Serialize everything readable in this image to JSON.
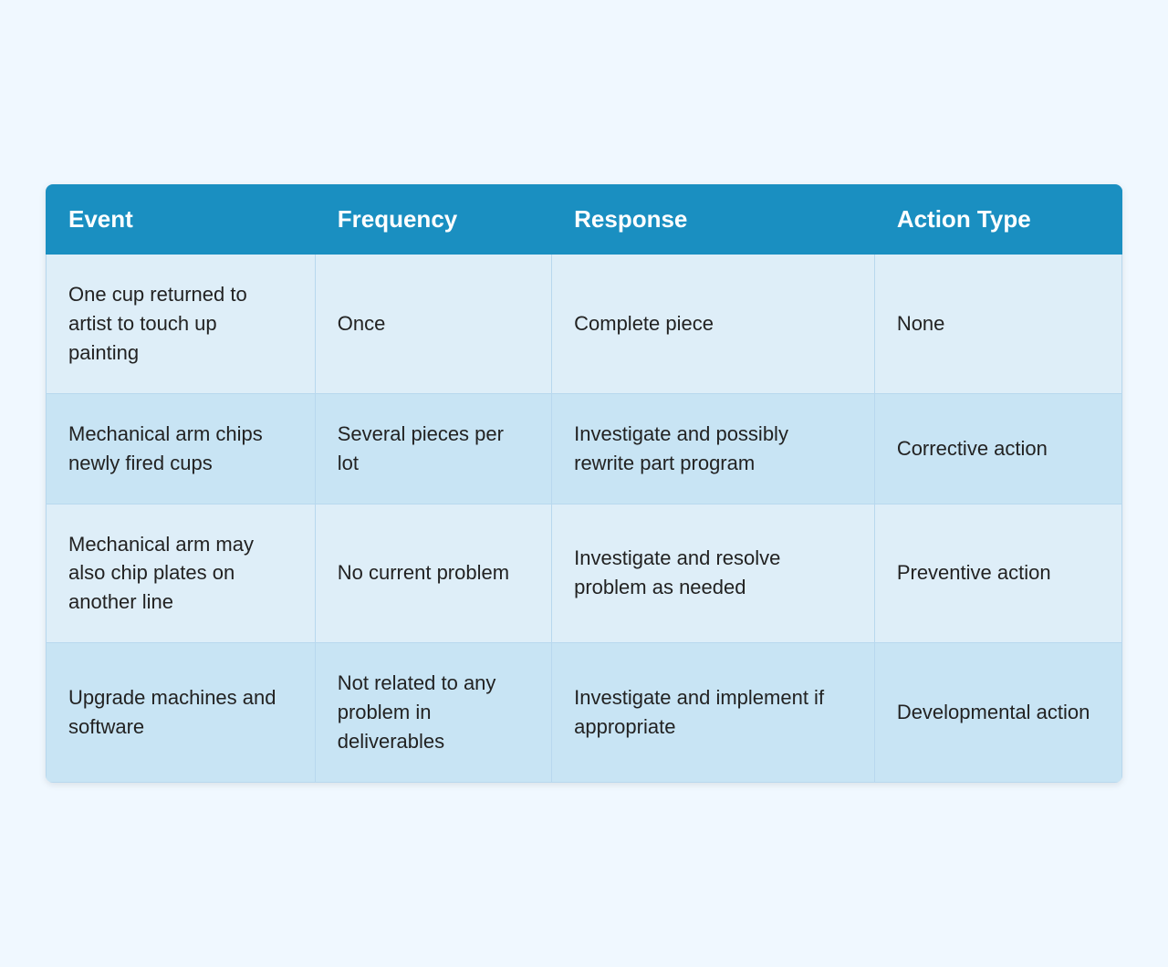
{
  "table": {
    "headers": {
      "event": "Event",
      "frequency": "Frequency",
      "response": "Response",
      "action_type": "Action Type"
    },
    "rows": [
      {
        "event": "One cup returned to artist to touch up painting",
        "frequency": "Once",
        "response": "Complete piece",
        "action_type": "None"
      },
      {
        "event": "Mechanical arm chips newly fired cups",
        "frequency": "Several pieces per lot",
        "response": "Investigate and possibly rewrite part program",
        "action_type": "Corrective action"
      },
      {
        "event": "Mechanical arm may also chip plates on another line",
        "frequency": "No current problem",
        "response": "Investigate and resolve problem as needed",
        "action_type": "Preventive action"
      },
      {
        "event": "Upgrade machines and software",
        "frequency": "Not related to any problem in deliverables",
        "response": "Investigate and implement if appropriate",
        "action_type": "Developmental action"
      }
    ]
  }
}
